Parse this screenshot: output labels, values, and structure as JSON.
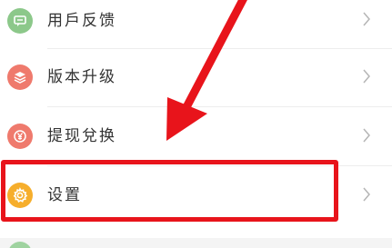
{
  "menu": {
    "items": [
      {
        "label": "用戶反馈",
        "icon": "message-icon",
        "icon_color": "#8cc88a"
      },
      {
        "label": "版本升级",
        "icon": "layers-icon",
        "icon_color": "#ef7a6d"
      },
      {
        "label": "提现兌换",
        "icon": "yen-icon",
        "icon_color": "#ef7a6d"
      },
      {
        "label": "设置",
        "icon": "gear-icon",
        "icon_color": "#f6ae2c"
      }
    ]
  },
  "annotation": {
    "highlight_color": "#e8141b",
    "highlighted_item": "设置",
    "arrow": "red-arrow-pointing-to-settings"
  }
}
